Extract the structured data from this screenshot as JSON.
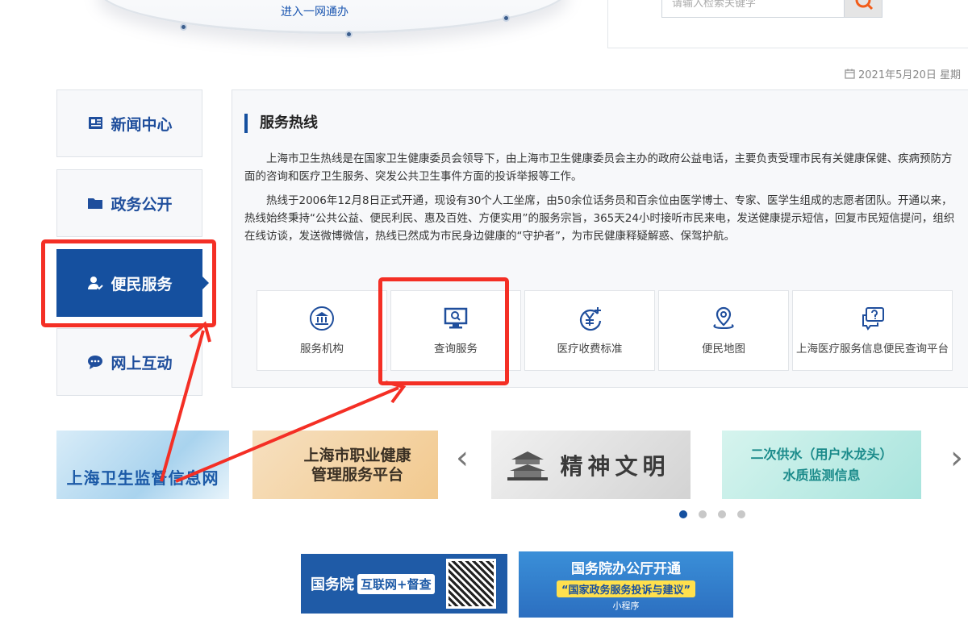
{
  "top": {
    "portal_link": "进入一网通办",
    "search_placeholder": "请输入检索关键字",
    "date": "2021年5月20日 星期"
  },
  "menu": [
    {
      "label": "新闻中心",
      "icon": "news-icon"
    },
    {
      "label": "政务公开",
      "icon": "folder-icon"
    },
    {
      "label": "便民服务",
      "icon": "user-check-icon",
      "active": true
    },
    {
      "label": "网上互动",
      "icon": "chat-icon"
    }
  ],
  "panel": {
    "title": "服务热线",
    "paragraphs": [
      "上海市卫生热线是在国家卫生健康委员会领导下，由上海市卫生健康委员会主办的政府公益电话，主要负责受理市民有关健康保健、疾病预防方面的咨询和医疗卫生服务、突发公共卫生事件方面的投诉举报等工作。",
      "热线于2006年12月8日正式开通，现设有30个人工坐席，由50余位话务员和百余位由医学博士、专家、医学生组成的志愿者团队。开通以来，热线始终秉持“公共公益、便民利民、惠及百姓、方便实用”的服务宗旨，365天24小时接听市民来电，发送健康提示短信，回复市民短信提问，组织在线访谈，发送微博微信，热线已然成为市民身边健康的“守护者”，为市民健康释疑解惑、保驾护航。"
    ],
    "services": [
      {
        "label": "服务机构",
        "icon": "institution-icon"
      },
      {
        "label": "查询服务",
        "icon": "query-monitor-icon"
      },
      {
        "label": "医疗收费标准",
        "icon": "yuan-fee-icon"
      },
      {
        "label": "便民地图",
        "icon": "map-pin-icon"
      },
      {
        "label": "上海医疗服务信息便民查询平台",
        "icon": "question-chat-icon"
      }
    ]
  },
  "banners": [
    {
      "text": "上海卫生监督信息网"
    },
    {
      "line1": "上海市职业健康",
      "line2": "管理服务平台"
    },
    {
      "text": "精神文明"
    },
    {
      "line1": "二次供水（用户水龙头）",
      "line2": "水质监测信息"
    }
  ],
  "logos": {
    "gov_name": "国务院",
    "gov_tag": "互联网+督查",
    "office_line1": "国务院办公厅开通",
    "office_line2": "“国家政务服务投诉与建议”",
    "office_line3": "小程序"
  },
  "colors": {
    "brand": "#15509f",
    "annotation_red": "#f42f25"
  }
}
